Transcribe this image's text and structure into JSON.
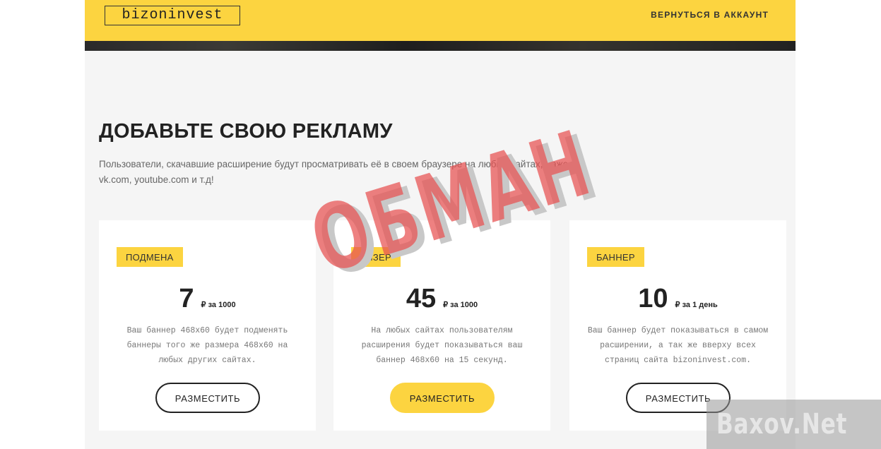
{
  "header": {
    "logo": "bizoninvest",
    "back_link": "ВЕРНУТЬСЯ В АККАУНТ"
  },
  "main": {
    "title": "ДОБАВЬТЕ СВОЮ РЕКЛАМУ",
    "subtitle": "Пользователи, скачавшие расширение будут просматривать её в своем браузере на любых сайтах, даже vk.com, youtube.com и т.д!"
  },
  "cards": [
    {
      "badge": "ПОДМЕНА",
      "price": "7",
      "unit": "₽ за 1000",
      "description": "Ваш баннер 468х60 будет подменять баннеры того же размера 468х60 на любых других сайтах.",
      "button": "РАЗМЕСТИТЬ"
    },
    {
      "badge": "ТИЗЕР",
      "price": "45",
      "unit": "₽ за 1000",
      "description": "На любых сайтах пользователям расширения будет показываться ваш баннер 468х60 на 15 секунд.",
      "button": "РАЗМЕСТИТЬ"
    },
    {
      "badge": "БАННЕР",
      "price": "10",
      "unit": "₽ за 1 день",
      "description": "Ваш баннер будет показываться в самом расширении, а так же вверху всех страниц сайта bizoninvest.com.",
      "button": "РАЗМЕСТИТЬ"
    }
  ],
  "overlay": {
    "stamp": "ОБМАН",
    "watermark": "Baxov.Net"
  },
  "colors": {
    "accent": "#fcd440",
    "stamp": "#e85050"
  }
}
